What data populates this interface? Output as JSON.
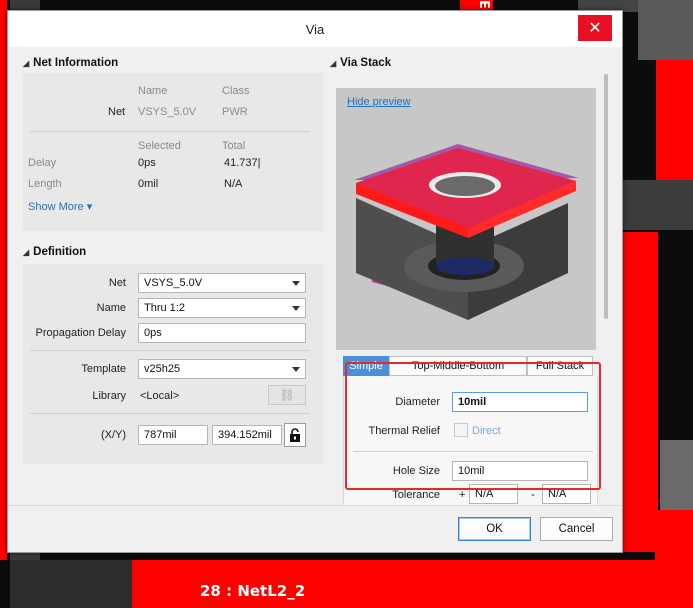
{
  "window": {
    "title": "Via",
    "close_glyph": "✕"
  },
  "background": {
    "net_label": "28 : NetL2_2",
    "vertical_text": "EN"
  },
  "net_information": {
    "header": "Net Information",
    "col_name": "Name",
    "col_class": "Class",
    "net_label": "Net",
    "net_name": "VSYS_5.0V",
    "net_class": "PWR",
    "col_selected": "Selected",
    "col_total": "Total",
    "delay_label": "Delay",
    "delay_selected": "0ps",
    "delay_total": "41.737|",
    "length_label": "Length",
    "length_selected": "0mil",
    "length_total": "N/A",
    "show_more": "Show More ▾"
  },
  "definition": {
    "header": "Definition",
    "net_label": "Net",
    "net_value": "VSYS_5.0V",
    "name_label": "Name",
    "name_value": "Thru 1:2",
    "prop_delay_label": "Propagation Delay",
    "prop_delay_value": "0ps",
    "template_label": "Template",
    "template_value": "v25h25",
    "library_label": "Library",
    "library_value": "<Local>",
    "xy_label": "(X/Y)",
    "x_value": "787mil",
    "y_value": "394.152mil"
  },
  "via_stack": {
    "header": "Via Stack",
    "hide_preview": "Hide preview",
    "tabs": [
      "Simple",
      "Top-Middle-Bottom",
      "Full Stack"
    ],
    "active_tab": 0,
    "diameter_label": "Diameter",
    "diameter_value": "10mil",
    "thermal_relief_label": "Thermal Relief",
    "thermal_relief_option": "Direct",
    "hole_size_label": "Hole Size",
    "hole_size_value": "10mil",
    "tolerance_label": "Tolerance",
    "tolerance_plus": "+",
    "tolerance_plus_value": "N/A",
    "tolerance_minus": "-",
    "tolerance_minus_value": "N/A"
  },
  "footer": {
    "ok_label": "OK",
    "cancel_label": "Cancel"
  },
  "colors": {
    "accent": "#4a90d9",
    "close_red": "#e81123",
    "highlight_red": "#e8262d",
    "link": "#1e73be"
  }
}
